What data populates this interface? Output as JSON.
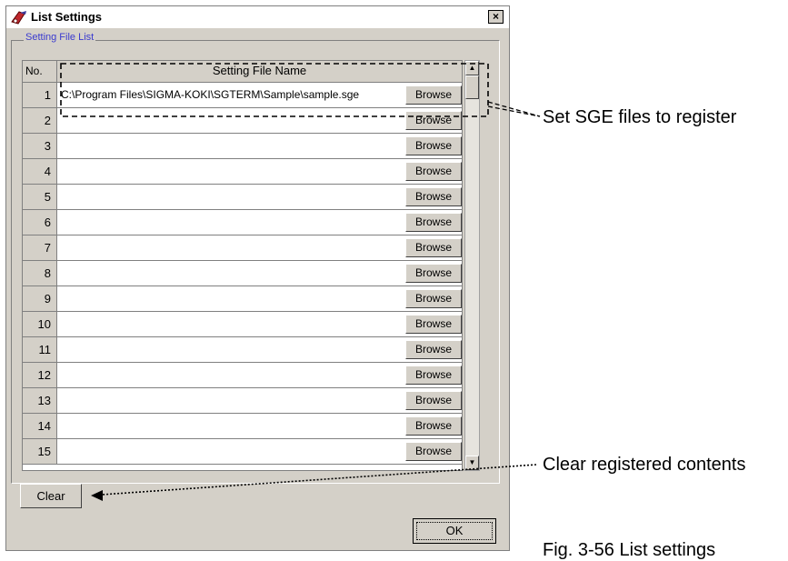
{
  "window": {
    "title": "List Settings",
    "close_label": "×"
  },
  "group": {
    "label": "Setting File List"
  },
  "table": {
    "col_no": "No.",
    "col_name": "Setting File Name",
    "rows": [
      {
        "no": "1",
        "path": "C:\\Program Files\\SIGMA-KOKI\\SGTERM\\Sample\\sample.sge",
        "browse": "Browse"
      },
      {
        "no": "2",
        "path": "",
        "browse": "Browse"
      },
      {
        "no": "3",
        "path": "",
        "browse": "Browse"
      },
      {
        "no": "4",
        "path": "",
        "browse": "Browse"
      },
      {
        "no": "5",
        "path": "",
        "browse": "Browse"
      },
      {
        "no": "6",
        "path": "",
        "browse": "Browse"
      },
      {
        "no": "7",
        "path": "",
        "browse": "Browse"
      },
      {
        "no": "8",
        "path": "",
        "browse": "Browse"
      },
      {
        "no": "9",
        "path": "",
        "browse": "Browse"
      },
      {
        "no": "10",
        "path": "",
        "browse": "Browse"
      },
      {
        "no": "11",
        "path": "",
        "browse": "Browse"
      },
      {
        "no": "12",
        "path": "",
        "browse": "Browse"
      },
      {
        "no": "13",
        "path": "",
        "browse": "Browse"
      },
      {
        "no": "14",
        "path": "",
        "browse": "Browse"
      },
      {
        "no": "15",
        "path": "",
        "browse": "Browse"
      }
    ]
  },
  "buttons": {
    "clear": "Clear",
    "ok": "OK"
  },
  "scrollbar": {
    "up": "▲",
    "down": "▼"
  },
  "annotations": {
    "register": "Set SGE files to register",
    "clear": "Clear registered contents",
    "caption": "Fig. 3-56 List settings"
  },
  "colors": {
    "dialog": "#d4d0c8",
    "group_label": "#3a3acf"
  },
  "icons": {
    "app": "sigma-koki-app-icon",
    "close": "close-icon"
  }
}
